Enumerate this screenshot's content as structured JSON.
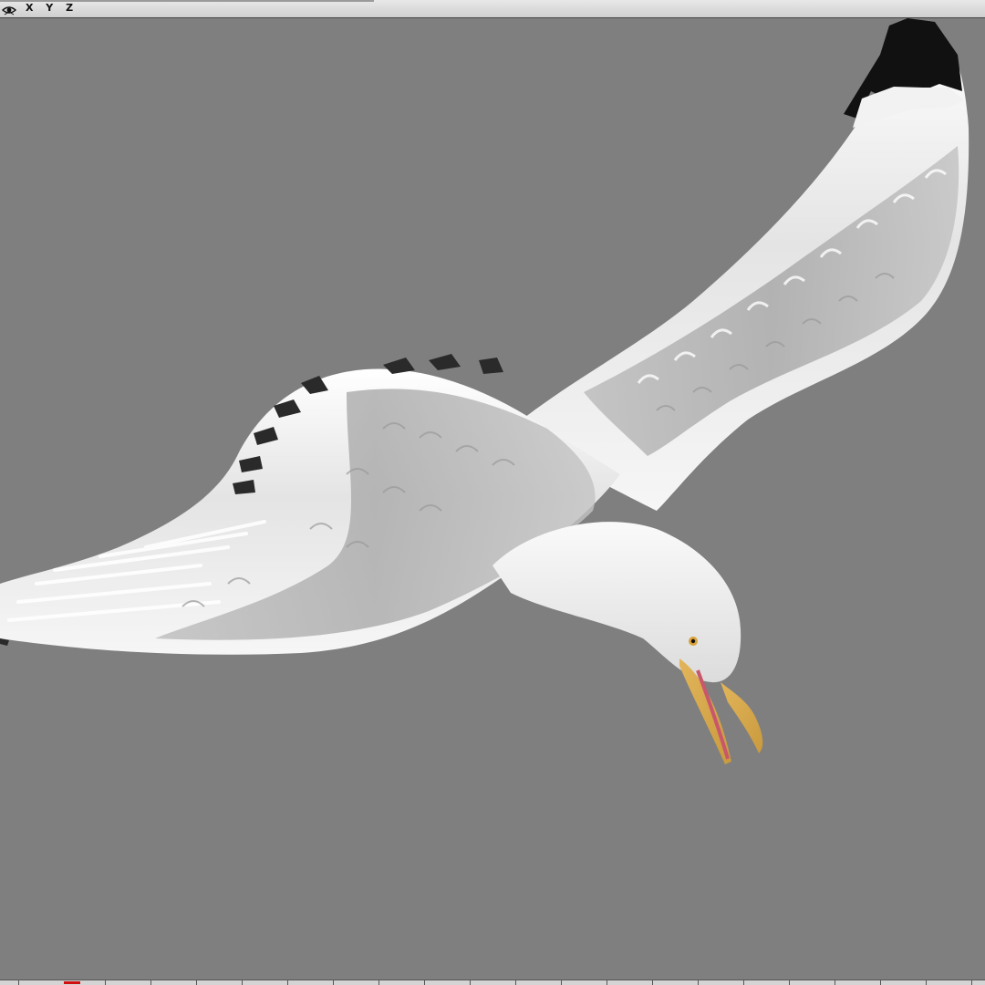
{
  "toolbar": {
    "axes_label": "X Y Z",
    "view_icon": "eye-icon"
  },
  "viewport": {
    "background_color": "#7f7f7f",
    "subject": "seagull-model"
  },
  "timeline": {
    "current_frame_color": "#d01010"
  }
}
